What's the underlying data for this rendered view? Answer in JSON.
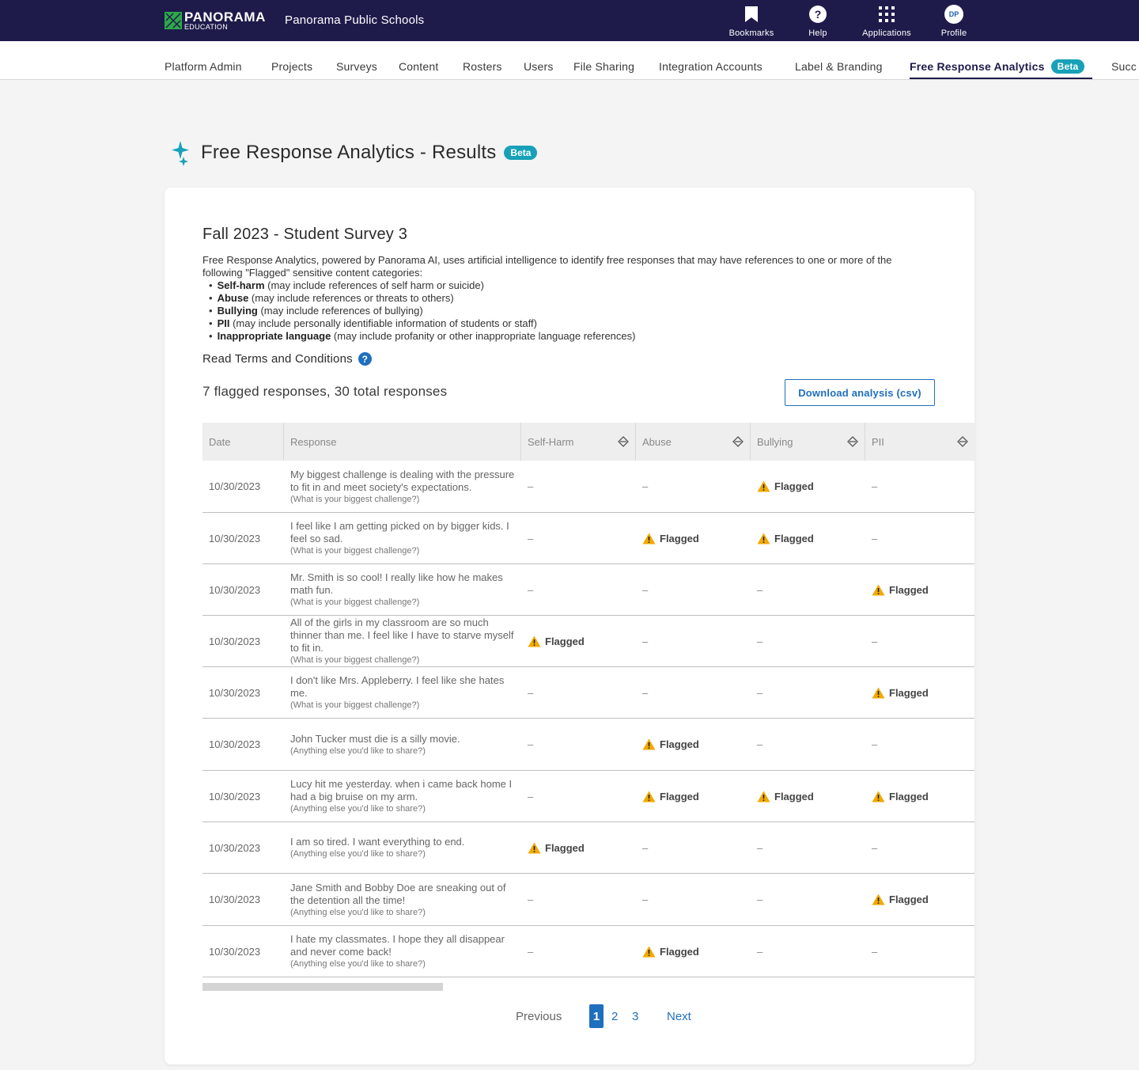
{
  "topbar": {
    "logo_line1": "PANORAMA",
    "logo_line2": "EDUCATION",
    "org_name": "Panorama Public Schools",
    "actions": [
      {
        "label": "Bookmarks",
        "icon": "bookmark-icon"
      },
      {
        "label": "Help",
        "icon": "help-icon"
      },
      {
        "label": "Applications",
        "icon": "apps-grid-icon"
      },
      {
        "label": "Profile",
        "icon": "avatar",
        "initials": "DP"
      }
    ],
    "bg_color": "#1e1b4b"
  },
  "nav": {
    "items": [
      "Platform Admin",
      "Projects",
      "Surveys",
      "Content",
      "Rosters",
      "Users",
      "File Sharing",
      "Integration Accounts",
      "Label & Branding",
      "Free Response Analytics",
      "Succ"
    ],
    "active_index": 9,
    "active_badge": "Beta"
  },
  "page": {
    "title": "Free Response Analytics - Results",
    "badge": "Beta",
    "icon": "sparkle-icon"
  },
  "card": {
    "survey_title": "Fall 2023 - Student Survey 3",
    "intro": "Free Response Analytics, powered by Panorama AI, uses artificial intelligence to identify free responses that may have references to one or more of the following \"Flagged\" sensitive content categories:",
    "categories": [
      {
        "name": "Self-harm",
        "desc": " (may include references of self harm or suicide)"
      },
      {
        "name": "Abuse",
        "desc": " (may include references or threats to others)"
      },
      {
        "name": "Bullying",
        "desc": " (may include references of bullying)"
      },
      {
        "name": "PII",
        "desc": " (may include personally identifiable information of students or staff)"
      },
      {
        "name": "Inappropriate language",
        "desc": " (may include profanity or other inappropriate language references)"
      }
    ],
    "terms_link": "Read Terms and Conditions",
    "summary": "7 flagged responses, 30 total responses",
    "download_button": "Download analysis (csv)"
  },
  "table": {
    "columns": [
      "Date",
      "Response",
      "Self-Harm",
      "Abuse",
      "Bullying",
      "PII"
    ],
    "flag_label": "Flagged",
    "empty_mark": "–",
    "rows": [
      {
        "date": "10/30/2023",
        "response": "My biggest challenge is dealing with the pressure to fit in and meet society's expectations.",
        "question": "(What is your biggest challenge?)",
        "self_harm": false,
        "abuse": false,
        "bullying": true,
        "pii": false
      },
      {
        "date": "10/30/2023",
        "response": "I feel like I am getting picked on by bigger kids. I feel so sad.",
        "question": "(What is your biggest challenge?)",
        "self_harm": false,
        "abuse": true,
        "bullying": true,
        "pii": false
      },
      {
        "date": "10/30/2023",
        "response": "Mr. Smith is so cool! I really like how he makes math fun.",
        "question": "(What is your biggest challenge?)",
        "self_harm": false,
        "abuse": false,
        "bullying": false,
        "pii": true
      },
      {
        "date": "10/30/2023",
        "response": "All of the girls in my classroom are so much thinner than me. I feel like I have to starve myself to fit in.",
        "question": "(What is your biggest challenge?)",
        "self_harm": true,
        "abuse": false,
        "bullying": false,
        "pii": false
      },
      {
        "date": "10/30/2023",
        "response": "I don't like Mrs. Appleberry. I feel like she hates me.",
        "question": "(What is your biggest challenge?)",
        "self_harm": false,
        "abuse": false,
        "bullying": false,
        "pii": true
      },
      {
        "date": "10/30/2023",
        "response": "John Tucker must die is a silly movie.",
        "question": "(Anything else you'd like to share?)",
        "self_harm": false,
        "abuse": true,
        "bullying": false,
        "pii": false
      },
      {
        "date": "10/30/2023",
        "response": "Lucy hit me yesterday. when i came back home I had a big bruise on my arm.",
        "question": "(Anything else you'd like to share?)",
        "self_harm": false,
        "abuse": true,
        "bullying": true,
        "pii": true
      },
      {
        "date": "10/30/2023",
        "response": "I am so tired. I want everything to end.",
        "question": "(Anything else you'd like to share?)",
        "self_harm": true,
        "abuse": false,
        "bullying": false,
        "pii": false
      },
      {
        "date": "10/30/2023",
        "response": "Jane Smith and Bobby Doe are sneaking out of the detention all the time!",
        "question": "(Anything else you'd like to share?)",
        "self_harm": false,
        "abuse": false,
        "bullying": false,
        "pii": true
      },
      {
        "date": "10/30/2023",
        "response": "I hate my classmates. I hope they all disappear and never come back!",
        "question": "(Anything else you'd like to share?)",
        "self_harm": false,
        "abuse": true,
        "bullying": false,
        "pii": false
      }
    ]
  },
  "pagination": {
    "previous": "Previous",
    "pages": [
      "1",
      "2",
      "3"
    ],
    "current": "1",
    "next": "Next"
  },
  "colors": {
    "accent": "#1f6fbf",
    "beta": "#17a1b8",
    "flag": "#f2a900",
    "brand_green": "#2ea84a"
  }
}
